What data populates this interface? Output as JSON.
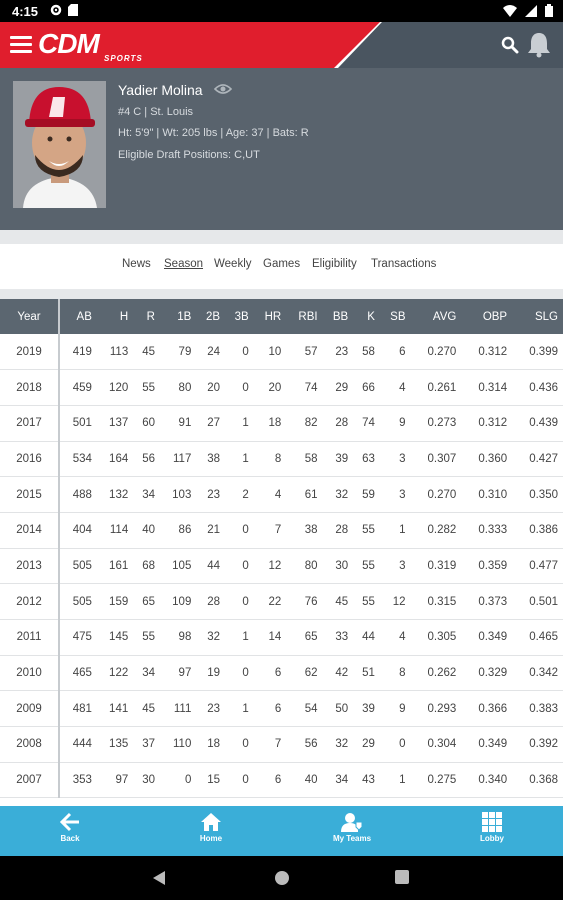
{
  "status_bar": {
    "time": "4:15"
  },
  "app": {
    "logo": "CDM",
    "logo_sub": "SPORTS"
  },
  "player": {
    "name": "Yadier Molina",
    "line1": "#4 C | St. Louis",
    "line2": "Ht: 5'9\" | Wt: 205 lbs | Age: 37 | Bats: R",
    "line3": "Eligible Draft Positions: C,UT"
  },
  "tabs": [
    "News",
    "Season",
    "Weekly",
    "Games",
    "Eligibility",
    "Transactions"
  ],
  "active_tab": "Season",
  "table": {
    "headers": [
      "Year",
      "AB",
      "H",
      "R",
      "1B",
      "2B",
      "3B",
      "HR",
      "RBI",
      "BB",
      "K",
      "SB",
      "AVG",
      "OBP",
      "SLG"
    ],
    "rows": [
      [
        "2019",
        "419",
        "113",
        "45",
        "79",
        "24",
        "0",
        "10",
        "57",
        "23",
        "58",
        "6",
        "0.270",
        "0.312",
        "0.399"
      ],
      [
        "2018",
        "459",
        "120",
        "55",
        "80",
        "20",
        "0",
        "20",
        "74",
        "29",
        "66",
        "4",
        "0.261",
        "0.314",
        "0.436"
      ],
      [
        "2017",
        "501",
        "137",
        "60",
        "91",
        "27",
        "1",
        "18",
        "82",
        "28",
        "74",
        "9",
        "0.273",
        "0.312",
        "0.439"
      ],
      [
        "2016",
        "534",
        "164",
        "56",
        "117",
        "38",
        "1",
        "8",
        "58",
        "39",
        "63",
        "3",
        "0.307",
        "0.360",
        "0.427"
      ],
      [
        "2015",
        "488",
        "132",
        "34",
        "103",
        "23",
        "2",
        "4",
        "61",
        "32",
        "59",
        "3",
        "0.270",
        "0.310",
        "0.350"
      ],
      [
        "2014",
        "404",
        "114",
        "40",
        "86",
        "21",
        "0",
        "7",
        "38",
        "28",
        "55",
        "1",
        "0.282",
        "0.333",
        "0.386"
      ],
      [
        "2013",
        "505",
        "161",
        "68",
        "105",
        "44",
        "0",
        "12",
        "80",
        "30",
        "55",
        "3",
        "0.319",
        "0.359",
        "0.477"
      ],
      [
        "2012",
        "505",
        "159",
        "65",
        "109",
        "28",
        "0",
        "22",
        "76",
        "45",
        "55",
        "12",
        "0.315",
        "0.373",
        "0.501"
      ],
      [
        "2011",
        "475",
        "145",
        "55",
        "98",
        "32",
        "1",
        "14",
        "65",
        "33",
        "44",
        "4",
        "0.305",
        "0.349",
        "0.465"
      ],
      [
        "2010",
        "465",
        "122",
        "34",
        "97",
        "19",
        "0",
        "6",
        "62",
        "42",
        "51",
        "8",
        "0.262",
        "0.329",
        "0.342"
      ],
      [
        "2009",
        "481",
        "141",
        "45",
        "111",
        "23",
        "1",
        "6",
        "54",
        "50",
        "39",
        "9",
        "0.293",
        "0.366",
        "0.383"
      ],
      [
        "2008",
        "444",
        "135",
        "37",
        "110",
        "18",
        "0",
        "7",
        "56",
        "32",
        "29",
        "0",
        "0.304",
        "0.349",
        "0.392"
      ],
      [
        "2007",
        "353",
        "97",
        "30",
        "0",
        "15",
        "0",
        "6",
        "40",
        "34",
        "43",
        "1",
        "0.275",
        "0.340",
        "0.368"
      ]
    ]
  },
  "bottom_nav": {
    "back": "Back",
    "home": "Home",
    "my_teams": "My Teams",
    "lobby": "Lobby"
  },
  "colors": {
    "brand_red": "#e01e2d",
    "header_gray": "#59636d",
    "nav_blue": "#3aaed8"
  }
}
